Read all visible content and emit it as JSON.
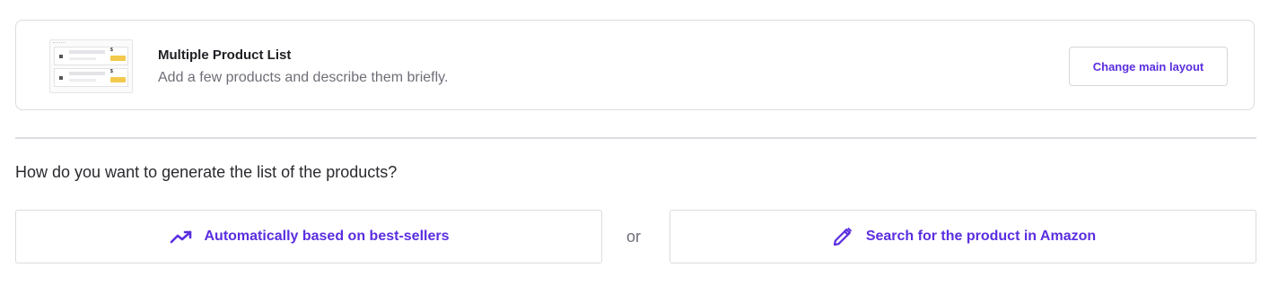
{
  "layout": {
    "title": "Multiple Product List",
    "description": "Add a few products and describe them briefly.",
    "change_button_label": "Change main layout",
    "thumbnail_icon": "product-list-thumbnail",
    "thumbnail_price_symbol": "$"
  },
  "question": "How do you want to generate the list of the products?",
  "options": {
    "auto": {
      "label": "Automatically based on best-sellers",
      "icon": "trending-up-icon"
    },
    "or": "or",
    "search": {
      "label": "Search for the product in Amazon",
      "icon": "pencil-icon"
    }
  },
  "colors": {
    "accent": "#5a2ee0",
    "border": "#dcdce0",
    "muted_text": "#6e6e78",
    "thumb_button": "#f2c94c"
  }
}
